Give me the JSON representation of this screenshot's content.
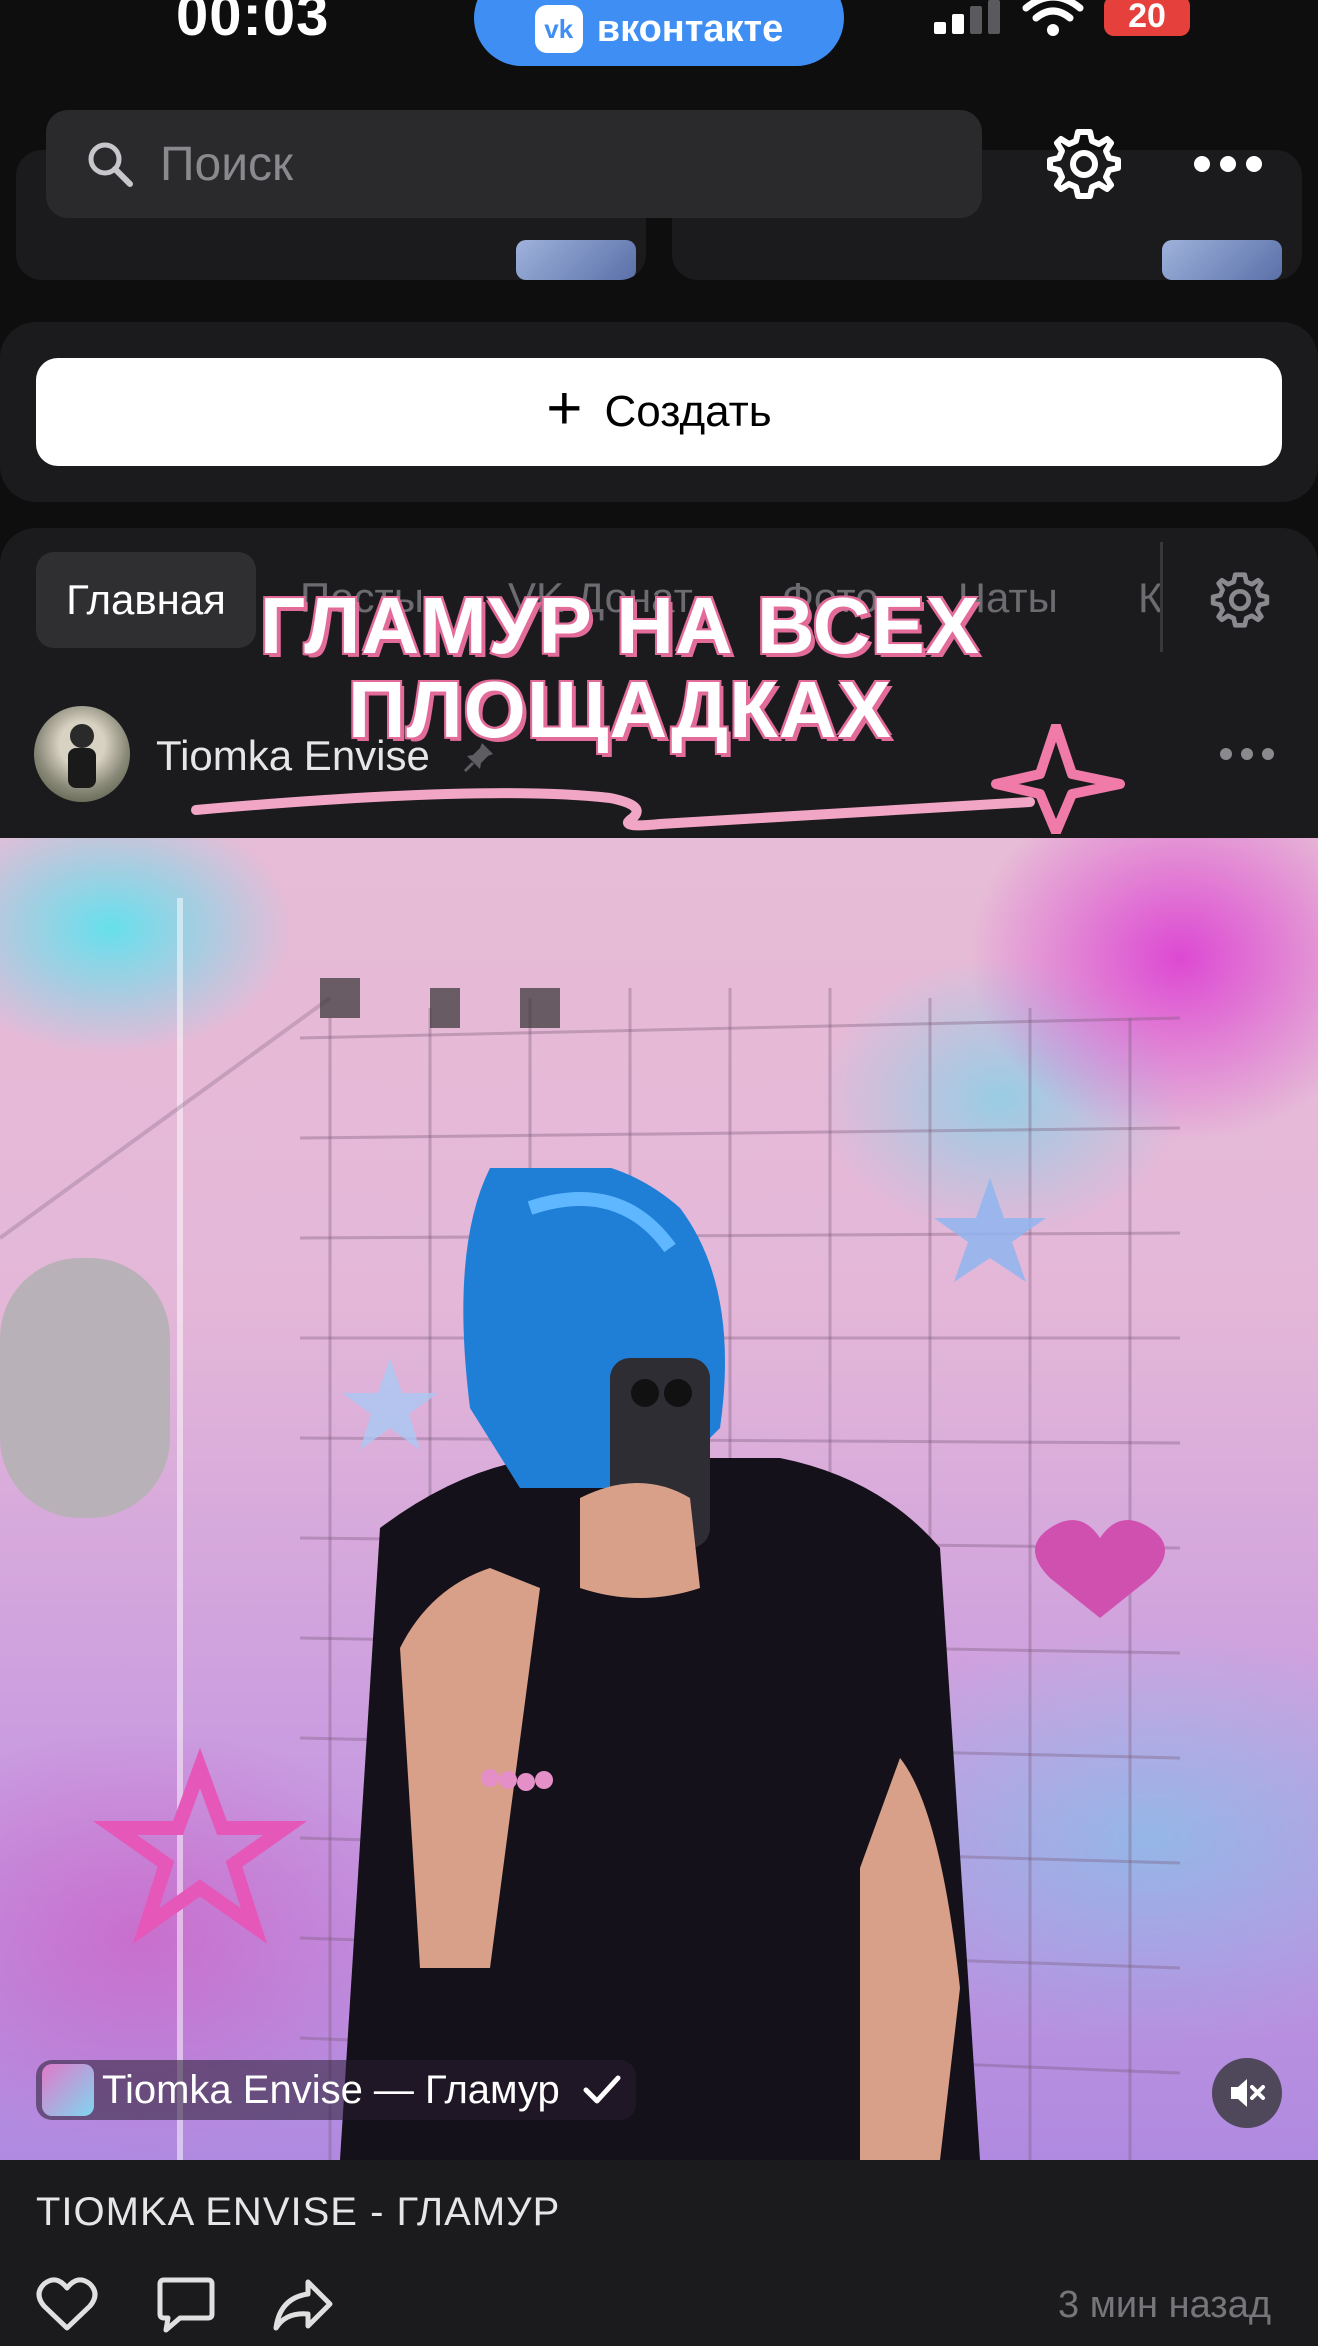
{
  "status_bar": {
    "time": "00:03",
    "app_pill": "вконтакте",
    "battery": "20"
  },
  "header": {
    "search_placeholder": "Поиск"
  },
  "create": {
    "label": "Создать"
  },
  "tabs": [
    {
      "label": "Главная",
      "active": true
    },
    {
      "label": "Посты"
    },
    {
      "label": "VK Донат"
    },
    {
      "label": "Фото"
    },
    {
      "label": "Чаты"
    },
    {
      "label": "К"
    }
  ],
  "promo": {
    "line1": "ГЛАМУР НА ВСЕХ",
    "line2": "ПЛОЩАДКАХ"
  },
  "post": {
    "author": "Tiomka Envise",
    "track_title": "Tiomka Envise — Гламур",
    "caption": "TIOMKA ENVISE - ГЛАМУР",
    "time_ago": "3 мин назад"
  },
  "colors": {
    "accent": "#3f8ef3",
    "battery": "#e5403b",
    "promo_shadow": "#e36b9a"
  }
}
